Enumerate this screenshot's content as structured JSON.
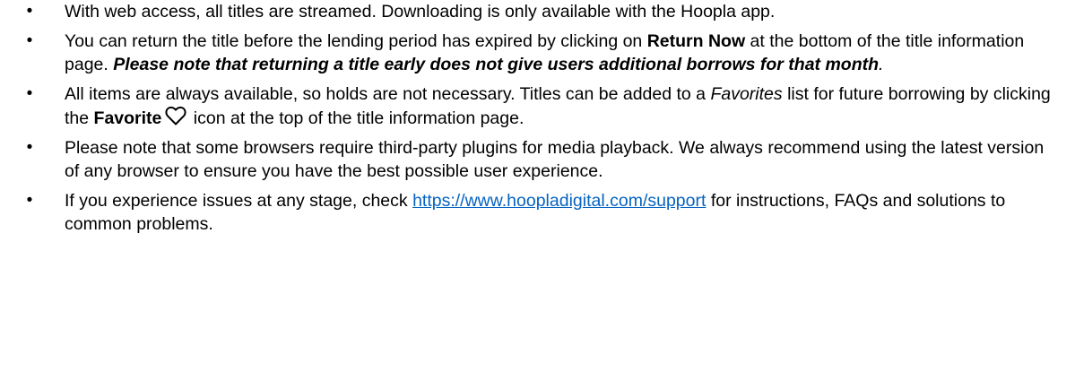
{
  "bullets": [
    {
      "text": "With web access, all titles are streamed. Downloading is only available with the Hoopla app."
    },
    {
      "text_a": "You can return the title before the lending period has expired by clicking on ",
      "bold": "Return Now",
      "text_b": " at the bottom of the title information page. ",
      "bold_italic": "Please note that returning a title early does not give users additional borrows for that month",
      "italic_end": "."
    },
    {
      "text_a": "All items are always available, so holds are not necessary. Titles can be added to a ",
      "italic": "Favorites",
      "text_b": " list for future borrowing by clicking the ",
      "bold": "Favorite",
      "icon": "heart-outline-icon",
      "text_c": " icon at the top of the title information page."
    },
    {
      "text": "Please note that some browsers require third-party plugins for media playback. We always recommend using the latest version of any browser to ensure you have the best possible user experience."
    },
    {
      "text_a": "If you experience issues at any stage, check ",
      "link": "https://www.hoopladigital.com/support",
      "text_b": " for instructions, FAQs and solutions to common problems."
    }
  ],
  "bullet_glyph": "•",
  "colors": {
    "text": "#000000",
    "link": "#0563c1",
    "background": "#ffffff"
  }
}
